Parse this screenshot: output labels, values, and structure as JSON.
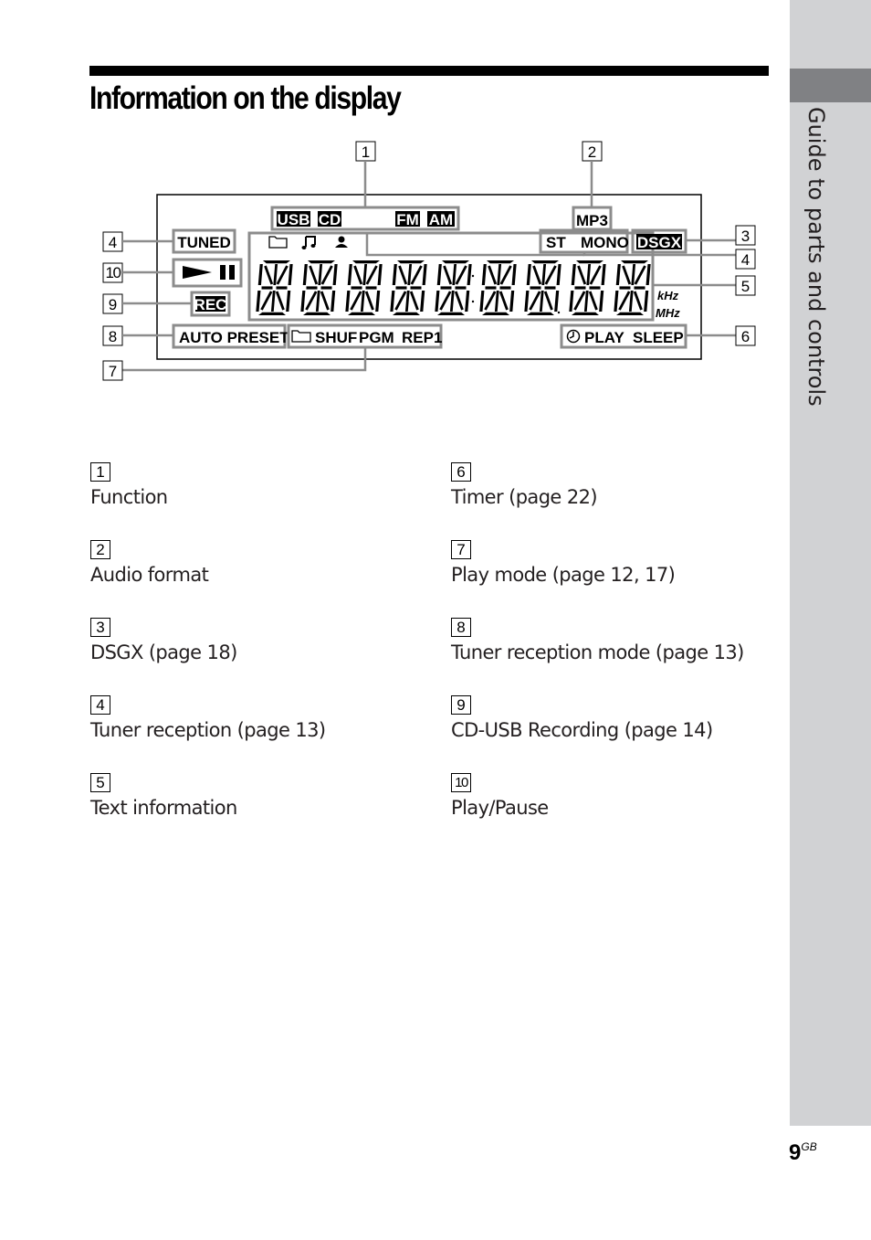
{
  "side_tab": {
    "label": "Guide to parts and controls"
  },
  "title": "Information on the display",
  "display": {
    "indicators": {
      "function": [
        "USB",
        "CD",
        "FM",
        "AM"
      ],
      "audio_format": "MP3",
      "tuned": "TUNED",
      "stereo": "ST",
      "mono": "MONO",
      "dsgx": "DSGX",
      "rec": "REC",
      "auto_preset": "AUTO PRESET",
      "play_mode": [
        "SHUF",
        "PGM",
        "REP1"
      ],
      "timer": [
        "PLAY",
        "SLEEP"
      ],
      "khz": "kHz",
      "mhz": "MHz",
      "icons": [
        "folder-icon",
        "music-note-icon",
        "person-icon",
        "play-icon",
        "pause-icon",
        "clock-icon"
      ]
    },
    "segment_digits": 9,
    "callouts": {
      "c1": "1",
      "c2": "2",
      "c3": "3",
      "c4a": "4",
      "c4b": "4",
      "c5": "5",
      "c6": "6",
      "c7": "7",
      "c8": "8",
      "c9": "9",
      "c10": "10"
    }
  },
  "legend": [
    {
      "num": "1",
      "text": "Function"
    },
    {
      "num": "2",
      "text": "Audio format"
    },
    {
      "num": "3",
      "text": "DSGX (page 18)"
    },
    {
      "num": "4",
      "text": "Tuner reception (page 13)"
    },
    {
      "num": "5",
      "text": "Text information"
    },
    {
      "num": "6",
      "text": "Timer (page 22)"
    },
    {
      "num": "7",
      "text": "Play mode (page 12, 17)"
    },
    {
      "num": "8",
      "text": "Tuner reception mode (page 13)"
    },
    {
      "num": "9",
      "text": "CD-USB Recording (page 14)"
    },
    {
      "num": "10",
      "text": "Play/Pause"
    }
  ],
  "page": {
    "number": "9",
    "suffix": "GB"
  }
}
